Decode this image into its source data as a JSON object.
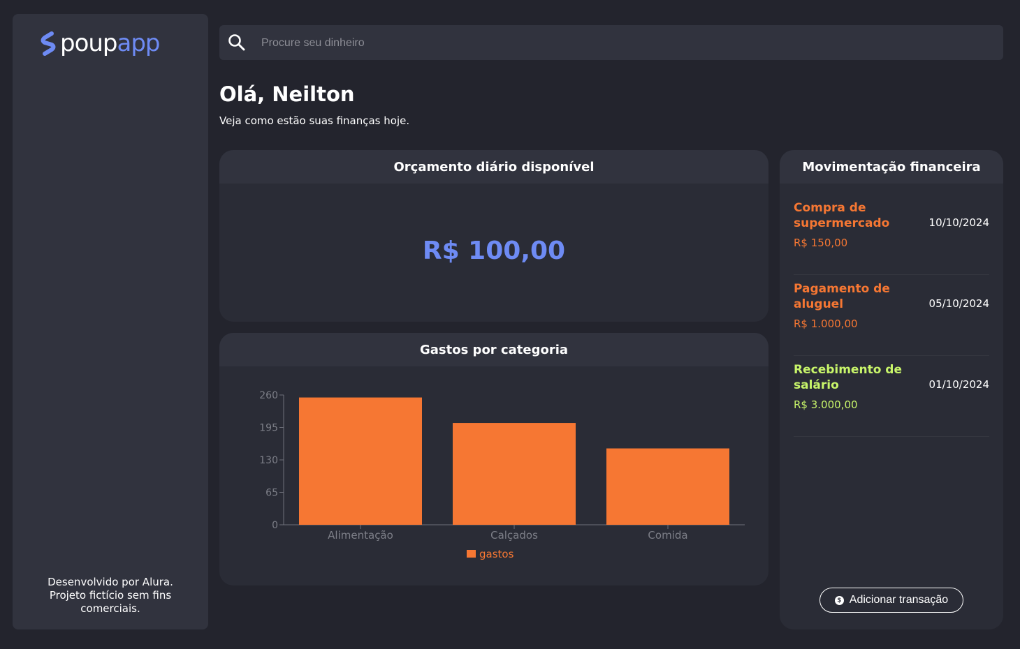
{
  "sidebar": {
    "logo_part1": "poup",
    "logo_part2": "app",
    "footer": "Desenvolvido por Alura. Projeto fictício sem fins comerciais."
  },
  "search": {
    "placeholder": "Procure seu dinheiro",
    "icon": "search-icon"
  },
  "header": {
    "greeting": "Olá, Neilton",
    "subtitle": "Veja como estão suas finanças hoje."
  },
  "budget": {
    "title": "Orçamento diário disponível",
    "value": "R$ 100,00"
  },
  "expenses": {
    "title": "Gastos por categoria"
  },
  "chart_data": {
    "type": "bar",
    "categories": [
      "Alimentação",
      "Calçados",
      "Comida"
    ],
    "series": [
      {
        "name": "gastos",
        "values": [
          255,
          204,
          153
        ]
      }
    ],
    "yticks": [
      0,
      65,
      130,
      195,
      260
    ],
    "ylim": [
      0,
      260
    ],
    "legend": "bottom",
    "color": "#f67733"
  },
  "transactions": {
    "title": "Movimentação financeira",
    "items": [
      {
        "title": "Compra de supermercado",
        "amount": "R$ 150,00",
        "date": "10/10/2024",
        "color": "#f67733"
      },
      {
        "title": "Pagamento de aluguel",
        "amount": "R$ 1.000,00",
        "date": "05/10/2024",
        "color": "#f67733"
      },
      {
        "title": "Recebimento de salário",
        "amount": "R$ 3.000,00",
        "date": "01/10/2024",
        "color": "#c8f56a"
      }
    ],
    "add_label": "Adicionar transação",
    "add_icon": "dollar-coin-icon"
  },
  "colors": {
    "accent": "#6e8bf4",
    "expense": "#f67733",
    "income": "#c8f56a",
    "background": "#23242d",
    "panel": "#31333e"
  }
}
